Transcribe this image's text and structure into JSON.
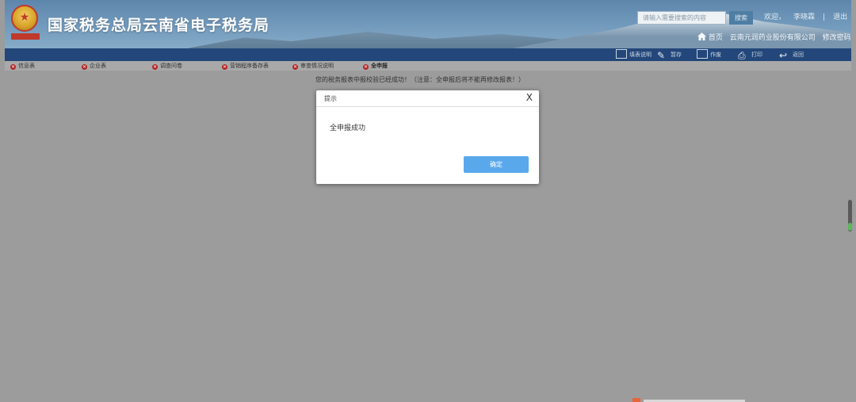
{
  "header": {
    "title": "国家税务总局云南省电子税务局",
    "search_placeholder": "请输入需要搜索的内容",
    "search_button": "搜索",
    "welcome": "欢迎，",
    "user": "李晓霖",
    "logout": "退出",
    "home": "首页",
    "company": "云南元润药业股份有限公司",
    "change_password": "修改密码"
  },
  "toolbar": {
    "items": [
      {
        "label": "填表说明",
        "icon": "document-icon"
      },
      {
        "label": "暂存",
        "icon": "pencil-icon"
      },
      {
        "label": "作废",
        "icon": "void-icon"
      },
      {
        "label": "打印",
        "icon": "printer-icon"
      },
      {
        "label": "返回",
        "icon": "back-arrow-icon"
      }
    ]
  },
  "tabs": [
    {
      "label": "信息表",
      "active": false
    },
    {
      "label": "企业表",
      "active": false
    },
    {
      "label": "调查问卷",
      "active": false
    },
    {
      "label": "营销程序备存表",
      "active": false
    },
    {
      "label": "审查情况说明",
      "active": false
    },
    {
      "label": "全申报",
      "active": true
    }
  ],
  "notice": "您的税务报表中报校验已经成功！（注意：全申报后将不能再修改报表！）",
  "dialog": {
    "title": "提示",
    "close": "X",
    "message": "全申报成功",
    "ok": "确定"
  },
  "colors": {
    "overlay": "#9c9c9c",
    "toolbar": "#23477a",
    "primary_button": "#5aa8ec",
    "tab_dot": "#b22222"
  }
}
